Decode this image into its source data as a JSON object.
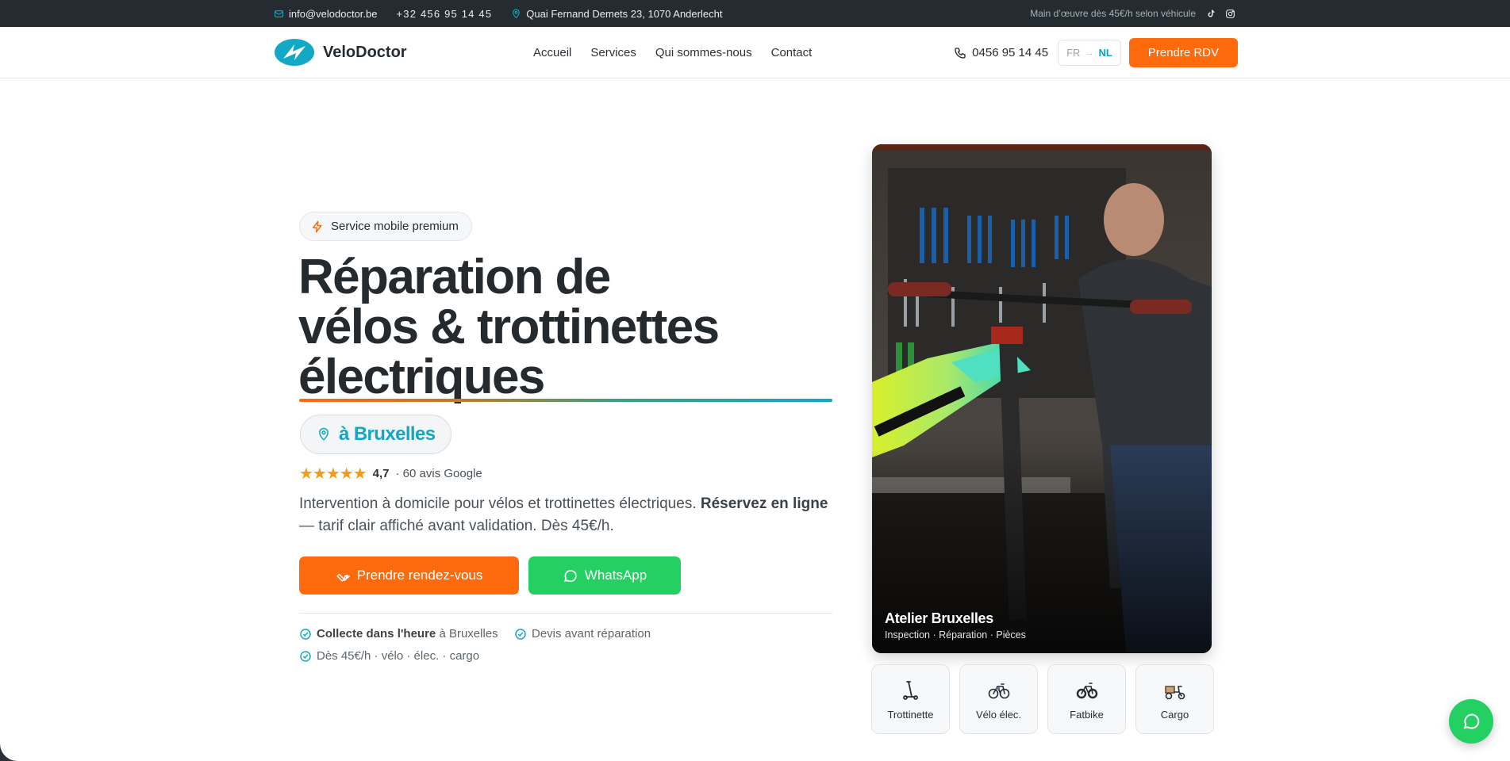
{
  "topbar": {
    "email": "info@velodoctor.be",
    "phone": "+32 456 95 14 45",
    "address": "Quai Fernand Demets 23, 1070 Anderlecht",
    "note": "Main d’œuvre dès 45€/h selon véhicule",
    "icons": [
      "mail-icon",
      "map-pin-icon",
      "tiktok-icon",
      "instagram-icon"
    ]
  },
  "header": {
    "brand": "VeloDoctor",
    "nav": [
      "Accueil",
      "Services",
      "Qui sommes-nous",
      "Contact"
    ],
    "phone": "0456 95 14 45",
    "lang_current": "FR",
    "lang_other": "NL",
    "cta": "Prendre RDV"
  },
  "hero": {
    "badge": "Service mobile premium",
    "title_line1": "Réparation de",
    "title_line2": "vélos & trottinettes",
    "title_line3": "électriques",
    "city": "à Bruxelles",
    "rating_score": "4,7",
    "rating_count": "· 60 avis Google",
    "rating_value": 4.7,
    "lead_text": "Intervention à domicile pour vélos et trottinettes électriques. ",
    "lead_bold": "Réservez en ligne",
    "lead_rest": " — tarif clair affiché avant validation. Dès 45€/h.",
    "btn_primary": "Prendre rendez-vous",
    "btn_whatsapp": "WhatsApp",
    "features": [
      {
        "bold": "Collecte dans l'heure",
        "text": " à Bruxelles"
      },
      {
        "bold": "",
        "text": "Devis avant réparation"
      },
      {
        "bold": "",
        "text": "Dès 45€/h · vélo · élec. · cargo"
      }
    ]
  },
  "photo": {
    "title": "Atelier Bruxelles",
    "subtitle": "Inspection · Réparation · Pièces"
  },
  "categories": [
    "Trottinette",
    "Vélo élec.",
    "Fatbike",
    "Cargo"
  ],
  "colors": {
    "accent": "#ff6a0d",
    "teal": "#14a6c4",
    "whatsapp": "#24d062",
    "dark": "#252c31"
  }
}
